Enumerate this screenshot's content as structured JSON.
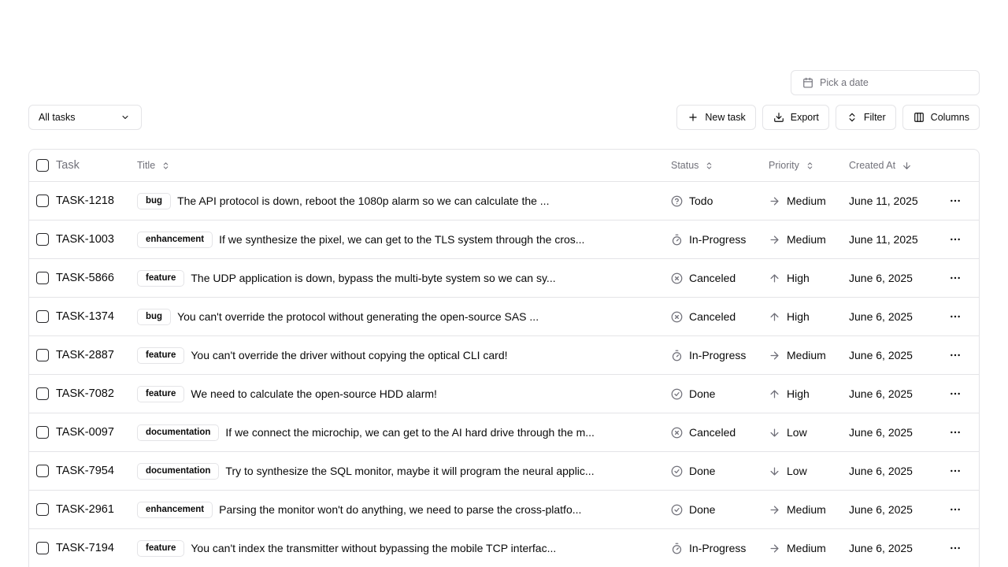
{
  "date_picker": {
    "placeholder": "Pick a date"
  },
  "view_select": {
    "label": "All tasks"
  },
  "toolbar": {
    "new_task": "New task",
    "export": "Export",
    "filter": "Filter",
    "columns": "Columns"
  },
  "table": {
    "headers": {
      "task": "Task",
      "title": "Title",
      "status": "Status",
      "priority": "Priority",
      "created": "Created At"
    },
    "rows": [
      {
        "id": "TASK-1218",
        "label": "bug",
        "title": "The API protocol is down, reboot the 1080p alarm so we can calculate the ...",
        "status": "Todo",
        "status_icon": "help-circle-icon",
        "priority": "Medium",
        "priority_icon": "arrow-right-icon",
        "created": "June 11, 2025"
      },
      {
        "id": "TASK-1003",
        "label": "enhancement",
        "title": "If we synthesize the pixel, we can get to the TLS system through the cros...",
        "status": "In-Progress",
        "status_icon": "timer-icon",
        "priority": "Medium",
        "priority_icon": "arrow-right-icon",
        "created": "June 11, 2025"
      },
      {
        "id": "TASK-5866",
        "label": "feature",
        "title": "The UDP application is down, bypass the multi-byte system so we can sy...",
        "status": "Canceled",
        "status_icon": "x-circle-icon",
        "priority": "High",
        "priority_icon": "arrow-up-icon",
        "created": "June 6, 2025"
      },
      {
        "id": "TASK-1374",
        "label": "bug",
        "title": "You can't override the protocol without generating the open-source SAS ...",
        "status": "Canceled",
        "status_icon": "x-circle-icon",
        "priority": "High",
        "priority_icon": "arrow-up-icon",
        "created": "June 6, 2025"
      },
      {
        "id": "TASK-2887",
        "label": "feature",
        "title": "You can't override the driver without copying the optical CLI card!",
        "status": "In-Progress",
        "status_icon": "timer-icon",
        "priority": "Medium",
        "priority_icon": "arrow-right-icon",
        "created": "June 6, 2025"
      },
      {
        "id": "TASK-7082",
        "label": "feature",
        "title": "We need to calculate the open-source HDD alarm!",
        "status": "Done",
        "status_icon": "check-circle-icon",
        "priority": "High",
        "priority_icon": "arrow-up-icon",
        "created": "June 6, 2025"
      },
      {
        "id": "TASK-0097",
        "label": "documentation",
        "title": "If we connect the microchip, we can get to the AI hard drive through the m...",
        "status": "Canceled",
        "status_icon": "x-circle-icon",
        "priority": "Low",
        "priority_icon": "arrow-down-icon",
        "created": "June 6, 2025"
      },
      {
        "id": "TASK-7954",
        "label": "documentation",
        "title": "Try to synthesize the SQL monitor, maybe it will program the neural applic...",
        "status": "Done",
        "status_icon": "check-circle-icon",
        "priority": "Low",
        "priority_icon": "arrow-down-icon",
        "created": "June 6, 2025"
      },
      {
        "id": "TASK-2961",
        "label": "enhancement",
        "title": "Parsing the monitor won't do anything, we need to parse the cross-platfo...",
        "status": "Done",
        "status_icon": "check-circle-icon",
        "priority": "Medium",
        "priority_icon": "arrow-right-icon",
        "created": "June 6, 2025"
      },
      {
        "id": "TASK-7194",
        "label": "feature",
        "title": "You can't index the transmitter without bypassing the mobile TCP interfac...",
        "status": "In-Progress",
        "status_icon": "timer-icon",
        "priority": "Medium",
        "priority_icon": "arrow-right-icon",
        "created": "June 6, 2025"
      }
    ]
  }
}
